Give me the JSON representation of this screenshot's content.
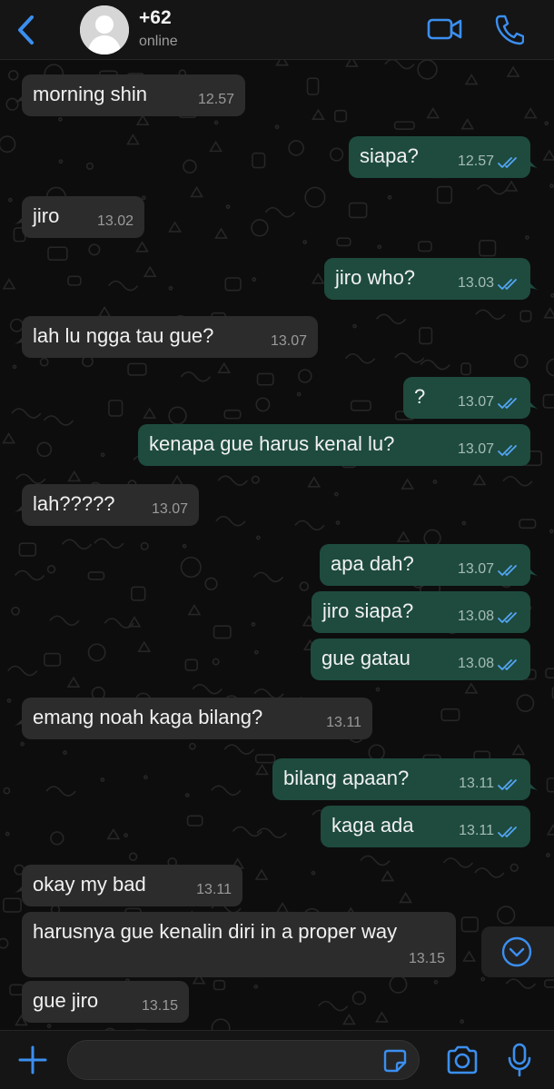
{
  "header": {
    "back_icon": "chevron-left-icon",
    "avatar_icon": "person-silhouette-icon",
    "contact_name": "+62",
    "status": "online",
    "video_icon": "video-camera-icon",
    "call_icon": "phone-icon"
  },
  "colors": {
    "accent": "#3b8ff0",
    "incoming_bubble": "#2c2c2c",
    "outgoing_bubble": "#1e4b3e",
    "read_ticks": "#53a6f5"
  },
  "messages": [
    {
      "dir": "in",
      "text": "morning shin",
      "time": "12.57"
    },
    {
      "dir": "out",
      "text": "siapa?",
      "time": "12.57",
      "read": true
    },
    {
      "dir": "in",
      "text": "jiro",
      "time": "13.02"
    },
    {
      "dir": "out",
      "text": "jiro who?",
      "time": "13.03",
      "read": true
    },
    {
      "dir": "in",
      "text": "lah lu ngga tau gue?",
      "time": "13.07"
    },
    {
      "dir": "out",
      "text": "?",
      "time": "13.07",
      "read": true
    },
    {
      "dir": "out",
      "text": "kenapa gue harus kenal lu?",
      "time": "13.07",
      "read": true
    },
    {
      "dir": "in",
      "text": "lah?????",
      "time": "13.07"
    },
    {
      "dir": "out",
      "text": "apa dah?",
      "time": "13.07",
      "read": true
    },
    {
      "dir": "out",
      "text": "jiro siapa?",
      "time": "13.08",
      "read": true
    },
    {
      "dir": "out",
      "text": "gue gatau",
      "time": "13.08",
      "read": true
    },
    {
      "dir": "in",
      "text": "emang noah kaga bilang?",
      "time": "13.11"
    },
    {
      "dir": "out",
      "text": "bilang apaan?",
      "time": "13.11",
      "read": true
    },
    {
      "dir": "out",
      "text": "kaga ada",
      "time": "13.11",
      "read": true
    },
    {
      "dir": "in",
      "text": "okay my bad",
      "time": "13.11"
    },
    {
      "dir": "in",
      "text": "harusnya gue kenalin diri in a proper way",
      "time": "13.15"
    },
    {
      "dir": "in",
      "text": "gue jiro",
      "time": "13.15"
    }
  ],
  "scroll_down_icon": "chevron-down-circle-icon",
  "input_bar": {
    "plus_icon": "plus-icon",
    "message_placeholder": "",
    "sticker_icon": "sticker-icon",
    "camera_icon": "camera-icon",
    "mic_icon": "microphone-icon"
  }
}
